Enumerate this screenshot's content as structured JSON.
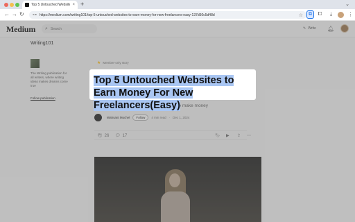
{
  "browser": {
    "tab_title": "Top 5 Untouched Websites to",
    "url": "https://medium.com/writing101/top-5-untouched-websites-to-earn-money-for-new-freelancers-easy-137d50c5d48d"
  },
  "site": {
    "logo": "Medium",
    "search_placeholder": "Search",
    "write_label": "Write"
  },
  "publication": {
    "name": "Writing101",
    "description": "The Writing publication for all writers, where writing ideas makes dreams come true",
    "follow_label": "Follow publication"
  },
  "article": {
    "member_label": "Member-only story",
    "title": "Top 5 Untouched Websites to Earn Money For New Freelancers(Easy)",
    "subtitle": "How these freelancing websites can help to make money",
    "author": "Wahsant Mochel",
    "follow_label": "Follow",
    "read_time": "4 min read",
    "date": "Dec 1, 2024",
    "claps": "26",
    "responses": "17"
  },
  "colors": {
    "highlight": "#a9c6f3",
    "member_star": "#ffc017"
  }
}
